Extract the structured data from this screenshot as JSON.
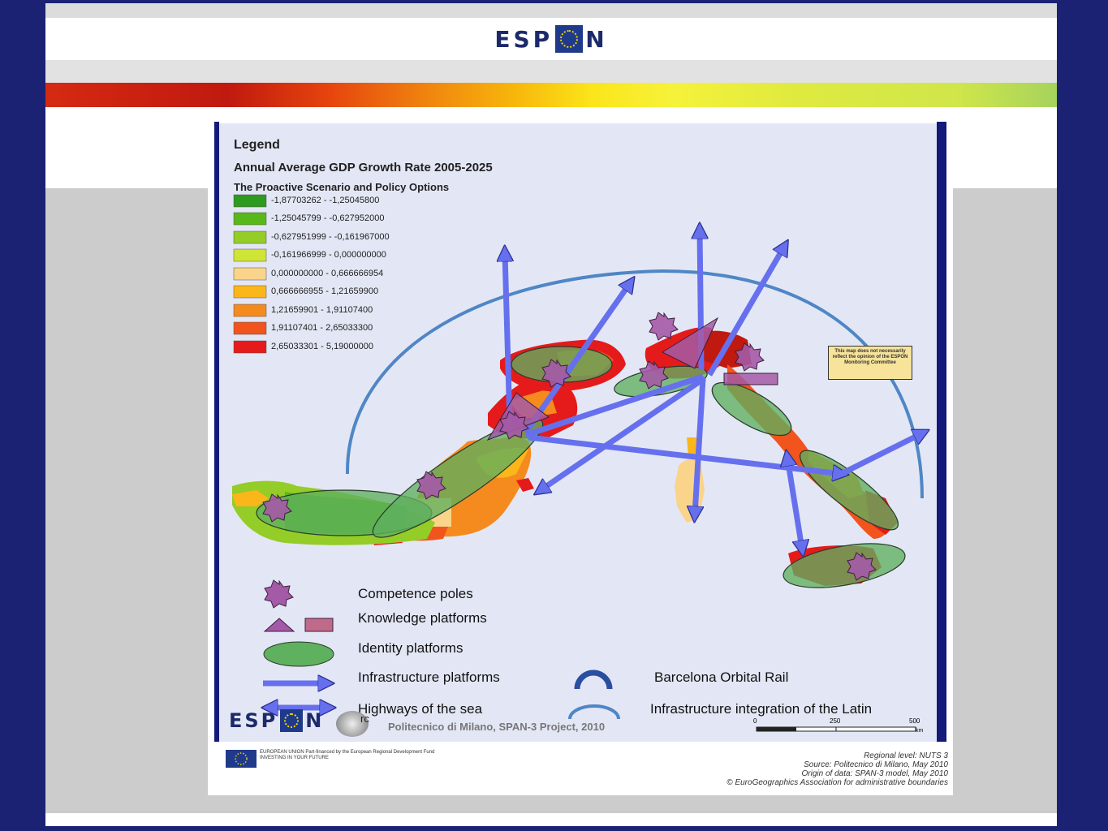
{
  "header": {
    "logo_text_left": "ESP",
    "logo_text_right": "N"
  },
  "map": {
    "legend_title": "Legend",
    "legend_subtitle": "Annual Average GDP Growth Rate 2005-2025",
    "legend_subtitle2": "The Proactive Scenario and Policy Options",
    "classes": [
      {
        "label": "-1,87703262 - -1,25045800",
        "color": "#2e9a1f"
      },
      {
        "label": "-1,25045799 - -0,627952000",
        "color": "#58b81a"
      },
      {
        "label": "-0,627951999 - -0,161967000",
        "color": "#94cc28"
      },
      {
        "label": "-0,161966999 - 0,000000000",
        "color": "#cfe536"
      },
      {
        "label": "0,000000000 - 0,666666954",
        "color": "#fad48a"
      },
      {
        "label": "0,666666955 - 1,21659900",
        "color": "#fbb619"
      },
      {
        "label": "1,21659901 - 1,91107400",
        "color": "#f58a1e"
      },
      {
        "label": "1,91107401 - 2,65033300",
        "color": "#f1541c"
      },
      {
        "label": "2,65033301 - 5,19000000",
        "color": "#e51b1b"
      }
    ],
    "symbols": {
      "competence_poles": "Competence poles",
      "knowledge_platforms": "Knowledge platforms",
      "identity_platforms": "Identity platforms",
      "infrastructure_platforms": "Infrastructure platforms",
      "highways_of_sea": "Highways of the sea",
      "barcelona_orbital": "Barcelona Orbital Rail",
      "latin_integration": "Infrastructure integration of the Latin"
    },
    "scale": {
      "ticks": [
        "0",
        "250",
        "500"
      ],
      "unit": "km"
    },
    "credit": "Politecnico di Milano, SPAN-3 Project, 2010",
    "bottom_logo_left": "ESP",
    "bottom_logo_right": "N",
    "cropped_text": "rc",
    "disclaimer": "This map does not necessarily reflect the opinion of the ESPON Monitoring Committee",
    "eu_text": "EUROPEAN UNION Part-financed by the European Regional Development Fund INVESTING IN YOUR FUTURE",
    "footnotes": [
      "Regional level: NUTS 3",
      "Source: Politecnico di Milano, May 2010",
      "Origin of data: SPAN-3 model, May 2010",
      "© EuroGeographics Association for administrative boundaries"
    ],
    "colors": {
      "map_background": "#e3e7f5",
      "frame_blue": "#141a7a",
      "identity_fill": "#5fb05f",
      "arrow_fill": "#6670ee",
      "pole_fill": "#a45aa6",
      "arc_stroke": "#4f86c6"
    }
  }
}
